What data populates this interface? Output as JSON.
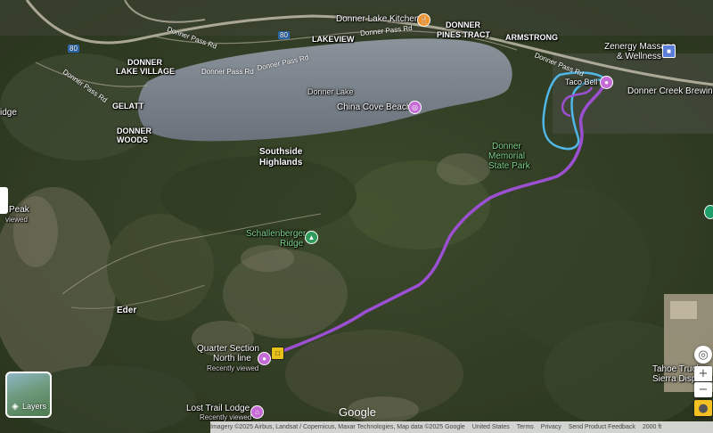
{
  "places": {
    "donner_lake_kitchen": "Donner Lake Kitchen",
    "donner_pines_tract_1": "DONNER",
    "donner_pines_tract_2": "PINES TRACT",
    "armstrong": "ARMSTRONG",
    "lakeview": "LAKEVIEW",
    "zenergy_1": "Zenergy Massage",
    "zenergy_2": "& Wellness",
    "taco_bell": "Taco Bell",
    "donner_creek_brewing": "Donner Creek Brewing",
    "donner_lake_village_1": "DONNER",
    "donner_lake_village_2": "LAKE VILLAGE",
    "donner_lake": "Donner Lake",
    "china_cove_beach": "China Cove Beach",
    "gelatt": "GELATT",
    "donner_woods_1": "DONNER",
    "donner_woods_2": "WOODS",
    "southside_1": "Southside",
    "southside_2": "Highlands",
    "donner_memorial_1": "Donner",
    "donner_memorial_2": "Memorial",
    "donner_memorial_3": "State Park",
    "schallenberger_1": "Schallenberger",
    "schallenberger_2": "Ridge",
    "eder": "Eder",
    "quarter_section_1": "Quarter Section",
    "quarter_section_2": "North line",
    "quarter_recent": "Recently viewed",
    "lost_trail_lodge": "Lost Trail Lodge",
    "lost_trail_recent": "Recently viewed",
    "tahoe_truckee_1": "Tahoe Truckee",
    "tahoe_truckee_2": "Sierra Disposal",
    "left_peak": "Peak",
    "left_viewed": "viewed",
    "left_ridge": "idge"
  },
  "roads": {
    "donner_pass_rd_1": "Donner Pass Rd",
    "donner_pass_rd_2": "Donner Pass Rd",
    "donner_pass_rd_3": "Donner Pass Rd",
    "donner_pass_rd_4": "Donner Pass Rd",
    "donner_pass_rd_5": "Donner Pass Rd",
    "donner_pass_rd_6": "Donner Pass Rd",
    "i80_a": "80",
    "i80_b": "80"
  },
  "controls": {
    "layers_label": "Layers",
    "zoom_in": "+",
    "zoom_out": "−"
  },
  "footer": {
    "imagery": "Imagery ©2025 Airbus, Landsat / Copernicus, Maxar Technologies, Map data ©2025 Google",
    "country": "United States",
    "terms": "Terms",
    "privacy": "Privacy",
    "feedback": "Send Product Feedback",
    "scale": "2000 ft"
  },
  "logo": "Google",
  "colors": {
    "route": "#9b4fd1",
    "boundary": "#4fb8e8",
    "water": "#7d8690",
    "park_label": "#7fd68a",
    "food_pin": "#f2922b",
    "poi_pin": "#c46bd6",
    "shop_pin": "#5b7fd8"
  }
}
